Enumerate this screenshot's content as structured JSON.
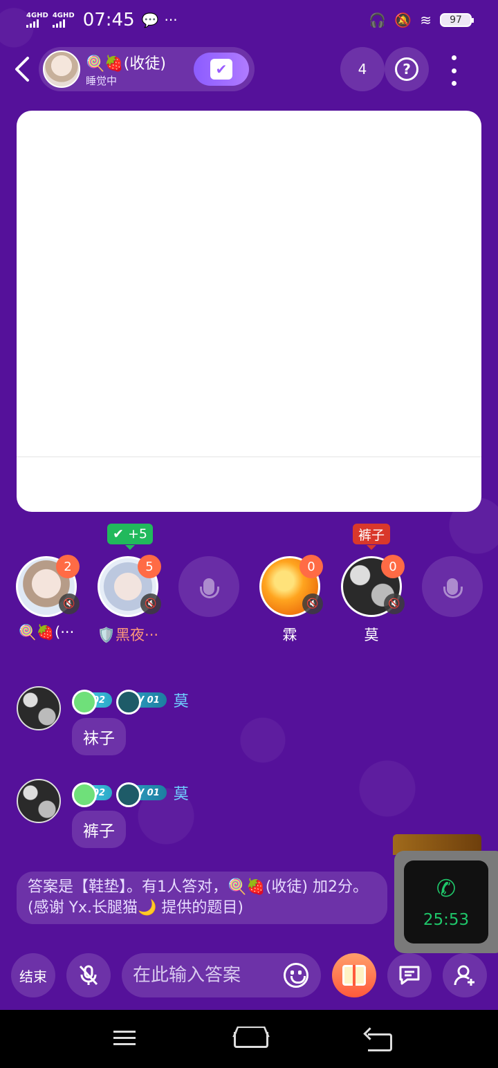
{
  "status_bar": {
    "net1": "4GHD",
    "net2": "4GHD",
    "time": "07:45",
    "dots": "···",
    "battery": "97"
  },
  "header": {
    "room_name": "🍭🍓(收徒)",
    "room_status": "睡觉中",
    "online_count": "4",
    "help_icon": "?",
    "checkin_icon": "✔"
  },
  "seats": [
    {
      "name": "🍭🍓(···",
      "score": "2"
    },
    {
      "name": "🛡️黑夜···",
      "score": "5",
      "tag": "✔ +5"
    },
    {
      "name": "",
      "empty": true
    },
    {
      "name": "霖",
      "score": "0"
    },
    {
      "name": "莫",
      "score": "0",
      "tag": "裤子"
    },
    {
      "name": "",
      "empty": true
    }
  ],
  "messages": [
    {
      "badge1": "02",
      "badge2": "V 01",
      "user": "莫",
      "text": "袜子"
    },
    {
      "badge1": "02",
      "badge2": "V 01",
      "user": "莫",
      "text": "裤子"
    }
  ],
  "system_message": "答案是【鞋垫】。有1人答对，🍭🍓(收徒) 加2分。(感谢 Yx.长腿猫🌙 提供的题目)",
  "call": {
    "phone_icon": "✆",
    "duration": "25:53"
  },
  "bottom_bar": {
    "end_label": "结束",
    "answer_placeholder": "在此输入答案"
  },
  "colors": {
    "background": "#55119a",
    "accent": "#9a5cff",
    "score_badge": "#ff6b45",
    "call_green": "#1fc76a"
  }
}
